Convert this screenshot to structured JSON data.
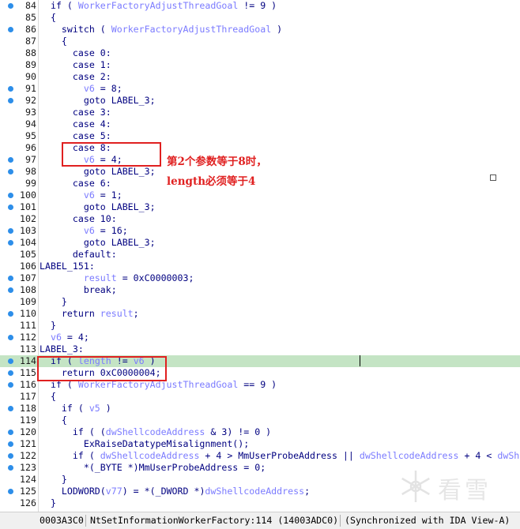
{
  "lines": [
    {
      "n": "84",
      "bp": true,
      "hl": false,
      "segs": [
        [
          "n",
          "  if ( "
        ],
        [
          "v",
          "WorkerFactoryAdjustThreadGoal"
        ],
        [
          "n",
          " != 9 )"
        ]
      ]
    },
    {
      "n": "85",
      "bp": false,
      "hl": false,
      "segs": [
        [
          "n",
          "  {"
        ]
      ]
    },
    {
      "n": "86",
      "bp": true,
      "hl": false,
      "segs": [
        [
          "n",
          "    switch ( "
        ],
        [
          "v",
          "WorkerFactoryAdjustThreadGoal"
        ],
        [
          "n",
          " )"
        ]
      ]
    },
    {
      "n": "87",
      "bp": false,
      "hl": false,
      "segs": [
        [
          "n",
          "    {"
        ]
      ]
    },
    {
      "n": "88",
      "bp": false,
      "hl": false,
      "segs": [
        [
          "n",
          "      case 0:"
        ]
      ]
    },
    {
      "n": "89",
      "bp": false,
      "hl": false,
      "segs": [
        [
          "n",
          "      case 1:"
        ]
      ]
    },
    {
      "n": "90",
      "bp": false,
      "hl": false,
      "segs": [
        [
          "n",
          "      case 2:"
        ]
      ]
    },
    {
      "n": "91",
      "bp": true,
      "hl": false,
      "segs": [
        [
          "n",
          "        "
        ],
        [
          "v",
          "v6"
        ],
        [
          "n",
          " = 8;"
        ]
      ]
    },
    {
      "n": "92",
      "bp": true,
      "hl": false,
      "segs": [
        [
          "n",
          "        goto LABEL_3;"
        ]
      ]
    },
    {
      "n": "93",
      "bp": false,
      "hl": false,
      "segs": [
        [
          "n",
          "      case 3:"
        ]
      ]
    },
    {
      "n": "94",
      "bp": false,
      "hl": false,
      "segs": [
        [
          "n",
          "      case 4:"
        ]
      ]
    },
    {
      "n": "95",
      "bp": false,
      "hl": false,
      "segs": [
        [
          "n",
          "      case 5:"
        ]
      ]
    },
    {
      "n": "96",
      "bp": false,
      "hl": false,
      "segs": [
        [
          "n",
          "      case 8:"
        ]
      ]
    },
    {
      "n": "97",
      "bp": true,
      "hl": false,
      "segs": [
        [
          "n",
          "        "
        ],
        [
          "v",
          "v6"
        ],
        [
          "n",
          " = 4;"
        ]
      ]
    },
    {
      "n": "98",
      "bp": true,
      "hl": false,
      "segs": [
        [
          "n",
          "        goto LABEL_3;"
        ]
      ]
    },
    {
      "n": "99",
      "bp": false,
      "hl": false,
      "segs": [
        [
          "n",
          "      case 6:"
        ]
      ]
    },
    {
      "n": "100",
      "bp": true,
      "hl": false,
      "segs": [
        [
          "n",
          "        "
        ],
        [
          "v",
          "v6"
        ],
        [
          "n",
          " = 1;"
        ]
      ]
    },
    {
      "n": "101",
      "bp": true,
      "hl": false,
      "segs": [
        [
          "n",
          "        goto LABEL_3;"
        ]
      ]
    },
    {
      "n": "102",
      "bp": false,
      "hl": false,
      "segs": [
        [
          "n",
          "      case 10:"
        ]
      ]
    },
    {
      "n": "103",
      "bp": true,
      "hl": false,
      "segs": [
        [
          "n",
          "        "
        ],
        [
          "v",
          "v6"
        ],
        [
          "n",
          " = 16;"
        ]
      ]
    },
    {
      "n": "104",
      "bp": true,
      "hl": false,
      "segs": [
        [
          "n",
          "        goto LABEL_3;"
        ]
      ]
    },
    {
      "n": "105",
      "bp": false,
      "hl": false,
      "segs": [
        [
          "n",
          "      default:"
        ]
      ]
    },
    {
      "n": "106",
      "bp": false,
      "hl": false,
      "segs": [
        [
          "n",
          "LABEL_151:"
        ]
      ]
    },
    {
      "n": "107",
      "bp": true,
      "hl": false,
      "segs": [
        [
          "n",
          "        "
        ],
        [
          "v",
          "result"
        ],
        [
          "n",
          " = 0xC0000003;"
        ]
      ]
    },
    {
      "n": "108",
      "bp": true,
      "hl": false,
      "segs": [
        [
          "n",
          "        break;"
        ]
      ]
    },
    {
      "n": "109",
      "bp": false,
      "hl": false,
      "segs": [
        [
          "n",
          "    }"
        ]
      ]
    },
    {
      "n": "110",
      "bp": true,
      "hl": false,
      "segs": [
        [
          "n",
          "    return "
        ],
        [
          "v",
          "result"
        ],
        [
          "n",
          ";"
        ]
      ]
    },
    {
      "n": "111",
      "bp": false,
      "hl": false,
      "segs": [
        [
          "n",
          "  }"
        ]
      ]
    },
    {
      "n": "112",
      "bp": true,
      "hl": false,
      "segs": [
        [
          "n",
          "  "
        ],
        [
          "v",
          "v6"
        ],
        [
          "n",
          " = 4;"
        ]
      ]
    },
    {
      "n": "113",
      "bp": false,
      "hl": false,
      "segs": [
        [
          "n",
          "LABEL_3:"
        ]
      ]
    },
    {
      "n": "114",
      "bp": true,
      "hl": true,
      "segs": [
        [
          "n",
          "  if ( "
        ],
        [
          "v",
          "length"
        ],
        [
          "n",
          " != "
        ],
        [
          "v",
          "v6"
        ],
        [
          "n",
          " )"
        ]
      ]
    },
    {
      "n": "115",
      "bp": true,
      "hl": false,
      "segs": [
        [
          "n",
          "    return 0xC0000004;"
        ]
      ]
    },
    {
      "n": "116",
      "bp": true,
      "hl": false,
      "segs": [
        [
          "n",
          "  if ( "
        ],
        [
          "v",
          "WorkerFactoryAdjustThreadGoal"
        ],
        [
          "n",
          " == 9 )"
        ]
      ]
    },
    {
      "n": "117",
      "bp": false,
      "hl": false,
      "segs": [
        [
          "n",
          "  {"
        ]
      ]
    },
    {
      "n": "118",
      "bp": true,
      "hl": false,
      "segs": [
        [
          "n",
          "    if ( "
        ],
        [
          "v",
          "v5"
        ],
        [
          "n",
          " )"
        ]
      ]
    },
    {
      "n": "119",
      "bp": false,
      "hl": false,
      "segs": [
        [
          "n",
          "    {"
        ]
      ]
    },
    {
      "n": "120",
      "bp": true,
      "hl": false,
      "segs": [
        [
          "n",
          "      if ( ("
        ],
        [
          "v",
          "dwShellcodeAddress"
        ],
        [
          "n",
          " & 3) != 0 )"
        ]
      ]
    },
    {
      "n": "121",
      "bp": true,
      "hl": false,
      "segs": [
        [
          "n",
          "        ExRaiseDatatypeMisalignment();"
        ]
      ]
    },
    {
      "n": "122",
      "bp": true,
      "hl": false,
      "segs": [
        [
          "n",
          "      if ( "
        ],
        [
          "v",
          "dwShellcodeAddress"
        ],
        [
          "n",
          " + 4 > MmUserProbeAddress || "
        ],
        [
          "v",
          "dwShellcodeAddress"
        ],
        [
          "n",
          " + 4 < "
        ],
        [
          "v",
          "dwSh"
        ]
      ]
    },
    {
      "n": "123",
      "bp": true,
      "hl": false,
      "segs": [
        [
          "n",
          "        *(_BYTE *)MmUserProbeAddress = 0;"
        ]
      ]
    },
    {
      "n": "124",
      "bp": false,
      "hl": false,
      "segs": [
        [
          "n",
          "    }"
        ]
      ]
    },
    {
      "n": "125",
      "bp": true,
      "hl": false,
      "segs": [
        [
          "n",
          "    LODWORD("
        ],
        [
          "v",
          "v77"
        ],
        [
          "n",
          ") = *(_DWORD *)"
        ],
        [
          "v",
          "dwShellcodeAddress"
        ],
        [
          "n",
          ";"
        ]
      ]
    },
    {
      "n": "126",
      "bp": false,
      "hl": false,
      "segs": [
        [
          "n",
          "  }"
        ]
      ]
    }
  ],
  "annotation": {
    "line1": "第2个参数等于8时，",
    "line2": "length必须等于4",
    "color": "#e02020"
  },
  "statusbar": {
    "address": "0003A3C0",
    "location": "NtSetInformationWorkerFactory:114 (14003ADC0)",
    "sync": "(Synchronized with IDA View-A)"
  },
  "watermark": {
    "text": "看雪"
  },
  "colors": {
    "keyword": "#000080",
    "variable": "#7b7bff",
    "highlight": "#c4e4c4",
    "breakpoint": "#2d8ee9"
  }
}
